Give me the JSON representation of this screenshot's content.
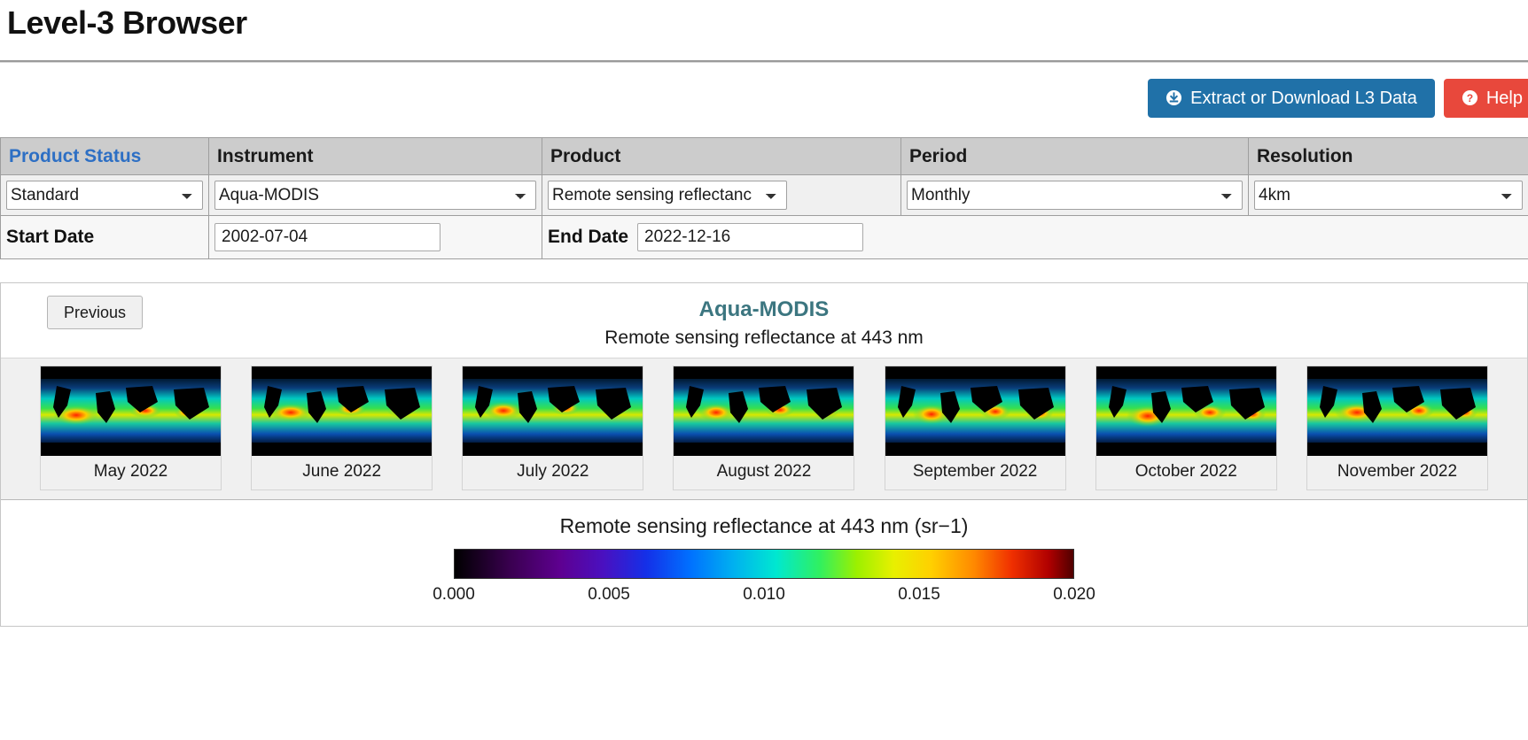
{
  "page": {
    "title": "Level-3 Browser"
  },
  "actions": {
    "extract_label": "Extract or Download L3 Data",
    "extract_icon": "download-circle-icon",
    "extract_color": "#2071a8",
    "help_label": "Help",
    "help_icon": "question-circle-icon",
    "help_color": "#e8483c"
  },
  "filters": {
    "headers": [
      "Product Status",
      "Instrument",
      "Product",
      "Period",
      "Resolution"
    ],
    "product_status": {
      "label": "Product Status",
      "value": "Standard",
      "options": [
        "Standard"
      ]
    },
    "instrument": {
      "label": "Instrument",
      "value": "Aqua-MODIS",
      "options": [
        "Aqua-MODIS"
      ]
    },
    "product": {
      "label": "Product",
      "value": "Remote sensing reflectanc",
      "options": [
        "Remote sensing reflectanc"
      ]
    },
    "period": {
      "label": "Period",
      "value": "Monthly",
      "options": [
        "Monthly"
      ]
    },
    "resolution": {
      "label": "Resolution",
      "value": "4km",
      "options": [
        "4km"
      ]
    },
    "start_date": {
      "label": "Start Date",
      "value": "2002-07-04"
    },
    "end_date": {
      "label": "End Date",
      "value": "2022-12-16"
    }
  },
  "gallery": {
    "previous_label": "Previous",
    "title": "Aqua-MODIS",
    "subtitle": "Remote sensing reflectance at 443 nm",
    "title_color": "#3c7680",
    "thumbnails": [
      {
        "label": "May 2022"
      },
      {
        "label": "June 2022"
      },
      {
        "label": "July 2022"
      },
      {
        "label": "August 2022"
      },
      {
        "label": "September 2022"
      },
      {
        "label": "October 2022"
      },
      {
        "label": "November 2022"
      }
    ]
  },
  "colorbar": {
    "title": "Remote sensing reflectance at 443 nm (sr−1)",
    "ticks": [
      "0.000",
      "0.005",
      "0.010",
      "0.015",
      "0.020"
    ],
    "min": 0.0,
    "max": 0.02
  }
}
